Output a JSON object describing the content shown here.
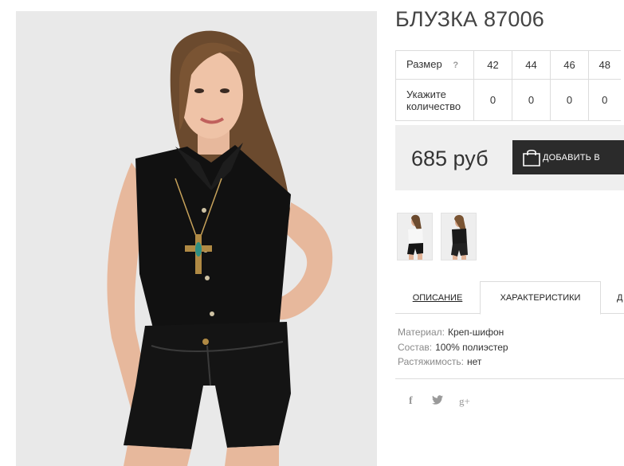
{
  "product": {
    "title": "БЛУЗКА 87006",
    "price": "685 руб",
    "add_to_cart_label": "ДОБАВИТЬ В"
  },
  "sizes": {
    "size_label": "Размер",
    "help_icon": "question-icon",
    "qty_label": "Укажите количество",
    "columns": [
      {
        "size": "42",
        "qty": "0"
      },
      {
        "size": "44",
        "qty": "0"
      },
      {
        "size": "46",
        "qty": "0"
      },
      {
        "size": "48",
        "qty": "0"
      }
    ]
  },
  "tabs": {
    "description": "ОПИСАНИЕ",
    "characteristics": "ХАРАКТЕРИСТИКИ",
    "third": "Д"
  },
  "specs": [
    {
      "key": "Материал:",
      "value": "Креп-шифон"
    },
    {
      "key": "Состав:",
      "value": "100% полиэстер"
    },
    {
      "key": "Растяжимость:",
      "value": "нет"
    }
  ],
  "social": {
    "facebook": "f",
    "twitter": "twitter-icon",
    "googleplus": "g+"
  },
  "colors": {
    "button_bg": "#2b2b2b",
    "price_box_bg": "#efefef",
    "border": "#dcdcdc"
  }
}
